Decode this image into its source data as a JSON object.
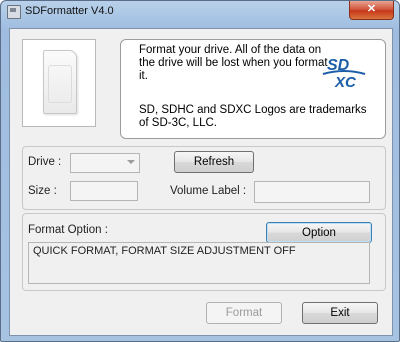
{
  "window": {
    "title": "SDFormatter V4.0",
    "close_label": "✕"
  },
  "info": {
    "line1": "Format your drive. All of the data on the drive will be lost when you format it.",
    "line2": "SD, SDHC and SDXC Logos are trademarks of SD-3C, LLC.",
    "logo_text_top": "SD",
    "logo_text_bottom": "XC"
  },
  "drive_group": {
    "drive_label": "Drive :",
    "drive_value": "",
    "refresh_label": "Refresh",
    "size_label": "Size :",
    "size_value": "",
    "volume_label": "Volume Label :",
    "volume_value": ""
  },
  "format_group": {
    "label": "Format Option :",
    "option_button": "Option",
    "status_text": "QUICK FORMAT, FORMAT SIZE ADJUSTMENT OFF"
  },
  "footer": {
    "format_button": "Format",
    "exit_button": "Exit"
  },
  "colors": {
    "logo_blue": "#1b5ea8"
  }
}
